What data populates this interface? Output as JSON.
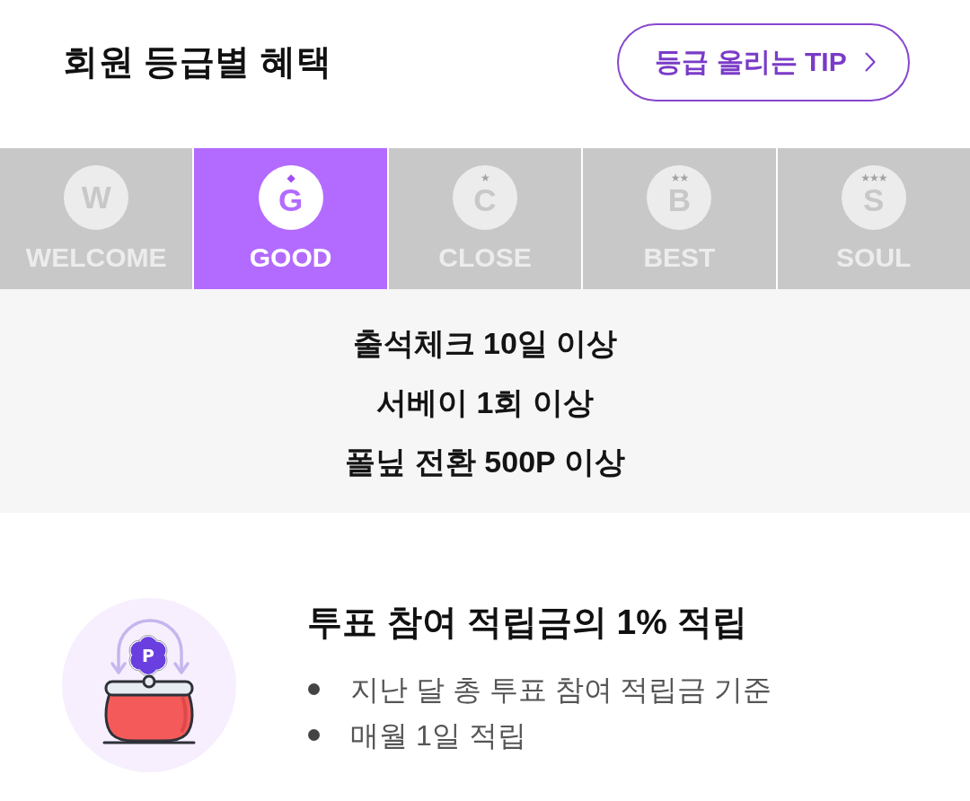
{
  "header": {
    "title": "회원 등급별 혜택",
    "tip_button": {
      "label": "등급 올리는 TIP"
    }
  },
  "tiers": [
    {
      "letter": "W",
      "label": "WELCOME",
      "selected": false
    },
    {
      "emblem": "◆",
      "letter": "G",
      "label": "GOOD",
      "selected": true
    },
    {
      "emblem": "★",
      "letter": "C",
      "label": "CLOSE",
      "selected": false
    },
    {
      "emblem": "★★",
      "letter": "B",
      "label": "BEST",
      "selected": false
    },
    {
      "emblem": "★★★",
      "letter": "S",
      "label": "SOUL",
      "selected": false
    }
  ],
  "requirements": [
    "출석체크 10일 이상",
    "서베이 1회 이상",
    "폴닢 전환 500P 이상"
  ],
  "benefits": [
    {
      "coin_label": "P",
      "title": "투표 참여 적립금의 1% 적립",
      "points": [
        "지난 달 총 투표 참여 적립금 기준",
        "매월 1일 적립"
      ]
    }
  ]
}
